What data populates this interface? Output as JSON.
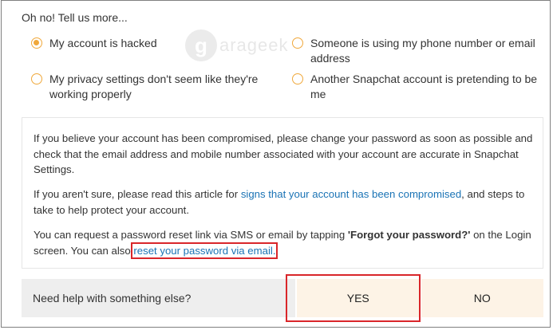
{
  "heading": "Oh no! Tell us more...",
  "options": [
    {
      "label": "My account is hacked",
      "checked": true
    },
    {
      "label": "Someone is using my phone number or email address",
      "checked": false
    },
    {
      "label": "My privacy settings don't seem like they're working properly",
      "checked": false
    },
    {
      "label": "Another Snapchat account is pretending to be me",
      "checked": false
    }
  ],
  "watermark": {
    "letter": "g",
    "text": "arageek"
  },
  "info": {
    "p1": "If you believe your account has been compromised, please change your password as soon as possible and check that the email address and mobile number associated with your account are accurate in Snapchat Settings.",
    "p2_before": "If you aren't sure, please read this article for ",
    "p2_link": "signs that your account has been compromised",
    "p2_after": ", and steps to take to help protect your account.",
    "p3_before": "You can request a password reset link via SMS or email by tapping ",
    "p3_bold": "'Forgot your password?'",
    "p3_mid": " on the Login screen. You can also ",
    "p3_link": "reset your password via email."
  },
  "footer": {
    "question": "Need help with something else?",
    "yes_label": "YES",
    "no_label": "NO"
  },
  "colors": {
    "accent": "#f0a83b",
    "link": "#1a73b5",
    "highlight": "#d9262a",
    "button_bg": "#fdf3e6"
  }
}
